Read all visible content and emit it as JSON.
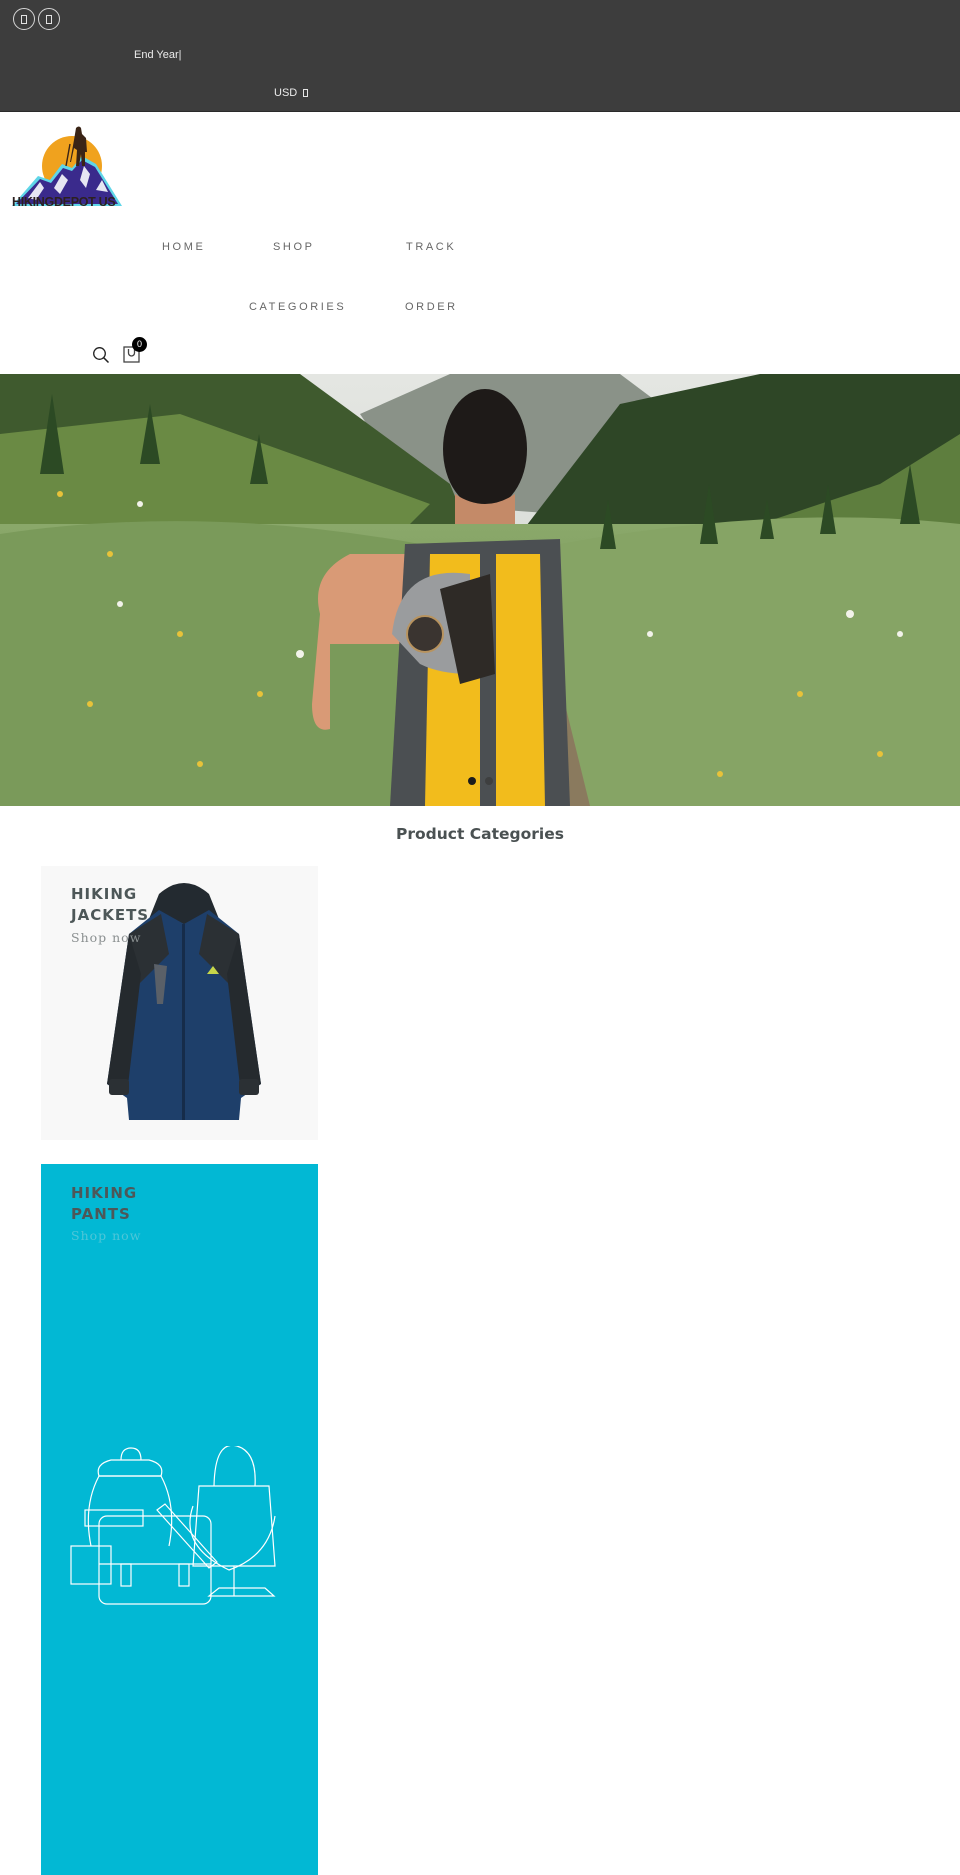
{
  "topbar": {
    "social_icons": [
      "facebook-icon",
      "instagram-icon"
    ],
    "promo_text": "End Year|",
    "currency": {
      "selected": "USD",
      "icon": "chevron-down-icon"
    }
  },
  "brand": {
    "logo_text": "HIKINGDEPOT US"
  },
  "nav": {
    "items": [
      {
        "label": "HOME"
      },
      {
        "label": "SHOP"
      },
      {
        "label": "TRACK"
      },
      {
        "label": "CATEGORIES"
      },
      {
        "label": "ORDER"
      }
    ]
  },
  "header_icons": {
    "search": "search-icon",
    "cart": "cart-icon",
    "cart_count": "0"
  },
  "hero": {
    "image_alt": "Hiker with yellow backpack in a green mountain meadow",
    "slides": 2,
    "active_slide": 1
  },
  "categories": {
    "title": "Product Categories",
    "items": [
      {
        "title_line1": "HIKING",
        "title_line2": "JACKETS",
        "link": "Shop now",
        "background": "#f8f8f8"
      },
      {
        "title_line1": "HIKING",
        "title_line2": "PANTS",
        "link": "Shop now",
        "background": "#02b8d4"
      }
    ]
  },
  "colors": {
    "topbar_bg": "#3d3d3d",
    "accent_cyan": "#02b8d4",
    "heading": "#4a5152"
  }
}
